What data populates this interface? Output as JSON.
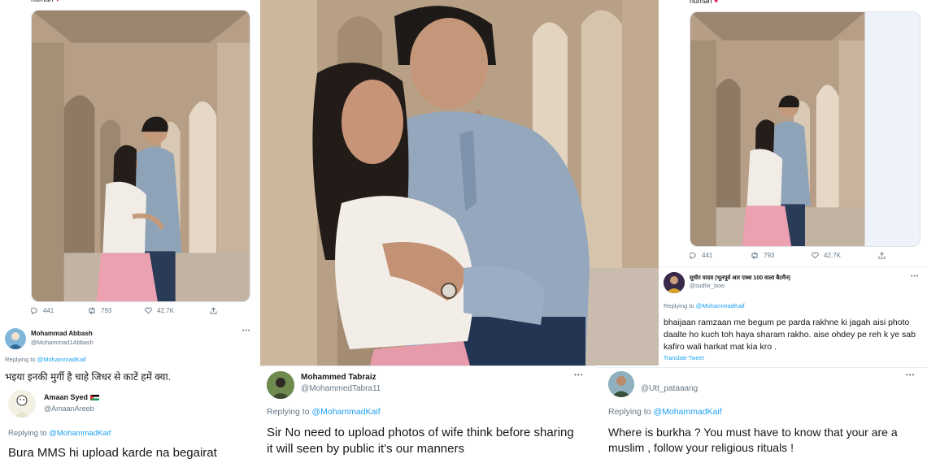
{
  "left_tweet": {
    "caption_tail": "human",
    "stats": {
      "replies": "441",
      "retweets": "793",
      "likes": "42.7K"
    }
  },
  "right_tweet": {
    "caption_tail": "human",
    "stats": {
      "replies": "441",
      "retweets": "793",
      "likes": "42.7K"
    }
  },
  "replies": [
    {
      "name": "Mohammad Abbash",
      "handle": "@Mohammad1Abbash",
      "replying_prefix": "Replying to",
      "replying_to": "@MohammadKaif",
      "text": "भइया इनकी मुर्गी है चाहे जिधर से काटें हमें क्या."
    },
    {
      "name": "Amaan Syed",
      "handle": "@AmaanAreeb",
      "replying_prefix": "Replying to",
      "replying_to": "@MohammadKaif",
      "text": "Bura MMS hi upload karde na begairat"
    },
    {
      "name": "सुधीर यादव (भूतपूर्व आर एक्स 100 वाला बैटमैन)",
      "handle": "@sudhir_bow",
      "replying_prefix": "Replying to",
      "replying_to": "@MohammadKaif",
      "text": "bhaijaan ramzaan me begum pe parda rakhne ki jagah aisi photo daalte ho kuch toh haya sharam rakho.  aise ohdey pe reh k ye sab kafiro wali harkat mat kia kro .",
      "translate": "Translate Tweet"
    },
    {
      "name": "Mohammed Tabraiz",
      "handle": "@MohammedTabra11",
      "replying_prefix": "Replying to",
      "replying_to": "@MohammadKaif",
      "text": "Sir No need to upload photos of wife think before sharing it will seen by public it's our manners"
    },
    {
      "name": "",
      "handle": "@Utt_pataaang",
      "replying_prefix": "Replying to",
      "replying_to": "@MohammadKaif",
      "text": "Where is burkha ? You must have to know that your are a muslim , follow your religious rituals  !"
    }
  ],
  "more_label": "•••",
  "icons": [
    "reply-icon",
    "retweet-icon",
    "heart-icon",
    "share-icon",
    "flag-icon",
    "more-icon"
  ],
  "colors": {
    "link": "#1da1f2",
    "muted": "#657786",
    "heart": "#e0245e"
  }
}
